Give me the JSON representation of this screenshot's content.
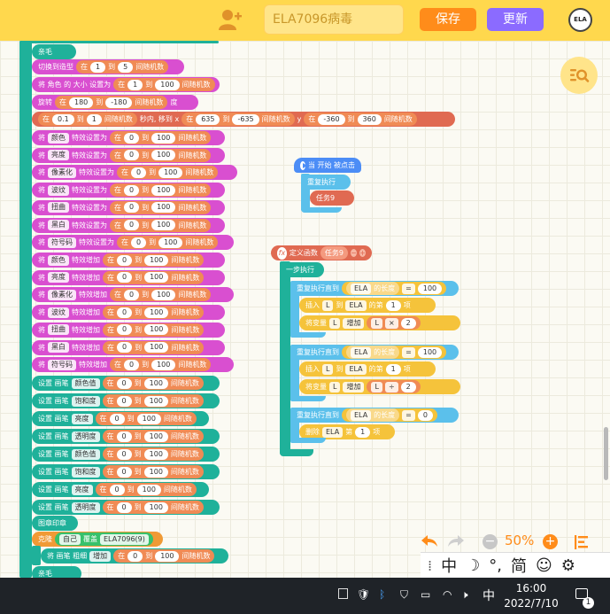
{
  "header": {
    "project_title": "ELA7096病毒",
    "save_label": "保存",
    "update_label": "更新",
    "logo_text": "ELA"
  },
  "blocks": {
    "stop": "亲毛",
    "switch_costume": {
      "label": "切换到造型",
      "in": "在",
      "a": "1",
      "to": "到",
      "b": "5",
      "rand": "间随机数"
    },
    "set_size": {
      "label": "将 角色 的 大小 设置为",
      "in": "在",
      "a": "1",
      "to": "到",
      "b": "100",
      "rand": "间随机数"
    },
    "rotate": {
      "label": "旋转",
      "a": "180",
      "to": "到",
      "b": "-180",
      "rand": "间随机数",
      "unit": "度"
    },
    "glide": {
      "in": "在",
      "a": "0.1",
      "to": "到",
      "b": "1",
      "rand": "间随机数",
      "label": "秒内, 移到 x",
      "c": "635",
      "d": "-635",
      "y": "y",
      "e": "-360",
      "f": "360"
    },
    "effects1": [
      {
        "set": "将",
        "effect": "颜色",
        "label": "特效设置为",
        "in": "在",
        "a": "0",
        "to": "到",
        "b": "100",
        "rand": "间随机数"
      },
      {
        "set": "将",
        "effect": "亮度",
        "label": "特效设置为",
        "in": "在",
        "a": "0",
        "to": "到",
        "b": "100",
        "rand": "间随机数"
      },
      {
        "set": "将",
        "effect": "像素化",
        "label": "特效设置为",
        "in": "在",
        "a": "0",
        "to": "到",
        "b": "100",
        "rand": "间随机数"
      },
      {
        "set": "将",
        "effect": "波纹",
        "label": "特效设置为",
        "in": "在",
        "a": "0",
        "to": "到",
        "b": "100",
        "rand": "间随机数"
      },
      {
        "set": "将",
        "effect": "扭曲",
        "label": "特效设置为",
        "in": "在",
        "a": "0",
        "to": "到",
        "b": "100",
        "rand": "间随机数"
      },
      {
        "set": "将",
        "effect": "黑白",
        "label": "特效设置为",
        "in": "在",
        "a": "0",
        "to": "到",
        "b": "100",
        "rand": "间随机数"
      },
      {
        "set": "将",
        "effect": "符号码",
        "label": "特效设置为",
        "in": "在",
        "a": "0",
        "to": "到",
        "b": "100",
        "rand": "间随机数"
      }
    ],
    "effects2": [
      {
        "set": "将",
        "effect": "颜色",
        "label": "特效增加",
        "in": "在",
        "a": "0",
        "to": "到",
        "b": "100",
        "rand": "间随机数"
      },
      {
        "set": "将",
        "effect": "亮度",
        "label": "特效增加",
        "in": "在",
        "a": "0",
        "to": "到",
        "b": "100",
        "rand": "间随机数"
      },
      {
        "set": "将",
        "effect": "像素化",
        "label": "特效增加",
        "in": "在",
        "a": "0",
        "to": "到",
        "b": "100",
        "rand": "间随机数"
      },
      {
        "set": "将",
        "effect": "波纹",
        "label": "特效增加",
        "in": "在",
        "a": "0",
        "to": "到",
        "b": "100",
        "rand": "间随机数"
      },
      {
        "set": "将",
        "effect": "扭曲",
        "label": "特效增加",
        "in": "在",
        "a": "0",
        "to": "到",
        "b": "100",
        "rand": "间随机数"
      },
      {
        "set": "将",
        "effect": "黑白",
        "label": "特效增加",
        "in": "在",
        "a": "0",
        "to": "到",
        "b": "100",
        "rand": "间随机数"
      },
      {
        "set": "将",
        "effect": "符号码",
        "label": "特效增加",
        "in": "在",
        "a": "0",
        "to": "到",
        "b": "100",
        "rand": "间随机数"
      }
    ],
    "pen": [
      {
        "label": "设置 画笔",
        "prop": "颜色值",
        "in": "在",
        "a": "0",
        "to": "到",
        "b": "100",
        "rand": "间随机数"
      },
      {
        "label": "设置 画笔",
        "prop": "饱和度",
        "in": "在",
        "a": "0",
        "to": "到",
        "b": "100",
        "rand": "间随机数"
      },
      {
        "label": "设置 画笔",
        "prop": "亮度",
        "in": "在",
        "a": "0",
        "to": "到",
        "b": "100",
        "rand": "间随机数"
      },
      {
        "label": "设置 画笔",
        "prop": "透明度",
        "in": "在",
        "a": "0",
        "to": "到",
        "b": "100",
        "rand": "间随机数"
      },
      {
        "label": "设置 画笔",
        "prop": "颜色值",
        "in": "在",
        "a": "0",
        "to": "到",
        "b": "100",
        "rand": "间随机数"
      },
      {
        "label": "设置 画笔",
        "prop": "饱和度",
        "in": "在",
        "a": "0",
        "to": "到",
        "b": "100",
        "rand": "间随机数"
      },
      {
        "label": "设置 画笔",
        "prop": "亮度",
        "in": "在",
        "a": "0",
        "to": "到",
        "b": "100",
        "rand": "间随机数"
      },
      {
        "label": "设置 画笔",
        "prop": "透明度",
        "in": "在",
        "a": "0",
        "to": "到",
        "b": "100",
        "rand": "间随机数"
      }
    ],
    "stamp": "图章印章",
    "clone": {
      "label": "克隆",
      "who": "自己",
      "sep": "覆盖",
      "name": "ELA7096(9)"
    },
    "pen_size": {
      "label": "将 画笔 粗细",
      "op": "增加",
      "in": "在",
      "a": "0",
      "to": "到",
      "b": "100",
      "rand": "间随机数"
    },
    "stop2": "亲毛"
  },
  "hat": {
    "title": "当 开始 被点击",
    "repeat": "重复执行",
    "task": "任务9"
  },
  "func": {
    "title": "定义函数",
    "name": "任务9",
    "step": "一步执行",
    "loops": [
      {
        "repeat": "重复执行直到",
        "var": "ELA",
        "len": "的长度",
        "op": "=",
        "val": "100",
        "insert": {
          "label": "插入",
          "a": "L",
          "to": "到",
          "list": "ELA",
          "pos": "的第",
          "n": "1",
          "item": "项"
        },
        "setvar": {
          "label": "将变量",
          "var": "L",
          "op": "增加",
          "a": "L",
          "op2": "×",
          "b": "2"
        }
      },
      {
        "repeat": "重复执行直到",
        "var": "ELA",
        "len": "的长度",
        "op": "=",
        "val": "100",
        "insert": {
          "label": "插入",
          "a": "L",
          "to": "到",
          "list": "ELA",
          "pos": "的第",
          "n": "1",
          "item": "项"
        },
        "setvar": {
          "label": "将变量",
          "var": "L",
          "op": "增加",
          "a": "L",
          "op2": "÷",
          "b": "2"
        }
      },
      {
        "repeat": "重复执行直到",
        "var": "ELA",
        "len": "的长度",
        "op": "=",
        "val": "0",
        "delete": {
          "label": "删除",
          "list": "ELA",
          "pos": "第",
          "n": "1",
          "item": "项"
        }
      }
    ]
  },
  "toolbar": {
    "zoom": "50%"
  },
  "ime": {
    "lang": "中",
    "punct": "°,",
    "mode": "简"
  },
  "taskbar": {
    "ime": "中",
    "time": "16:00",
    "date": "2022/7/10",
    "badge": "1"
  },
  "colors": {
    "header": "#ffd84d",
    "save": "#ff8c1a",
    "update": "#8b6bff"
  }
}
